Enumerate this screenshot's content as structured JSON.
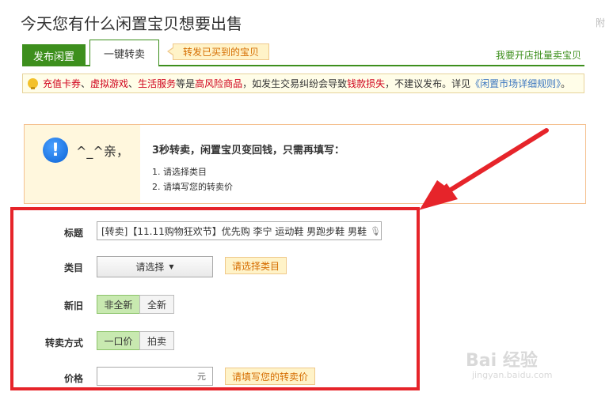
{
  "page": {
    "title": "今天您有什么闲置宝贝想要出售",
    "edge_text": "附"
  },
  "tabs": {
    "publish": "发布闲置",
    "one_click": "一键转卖",
    "bubble": "转发已买到的宝贝",
    "shop_link": "我要开店批量卖宝贝"
  },
  "warning": {
    "parts": [
      {
        "text": "充值卡券",
        "style": "red"
      },
      {
        "text": "、",
        "style": "normal"
      },
      {
        "text": "虚拟游戏",
        "style": "red"
      },
      {
        "text": "、",
        "style": "normal"
      },
      {
        "text": "生活服务",
        "style": "red"
      },
      {
        "text": "等是",
        "style": "normal"
      },
      {
        "text": "高风险商品",
        "style": "red"
      },
      {
        "text": "，如发生交易纠纷会导致",
        "style": "normal"
      },
      {
        "text": "钱款损失",
        "style": "red"
      },
      {
        "text": "，不建议发布。详见",
        "style": "normal"
      },
      {
        "text": "《闲置市场详细规则》",
        "style": "blue"
      },
      {
        "text": "。",
        "style": "normal"
      }
    ]
  },
  "notice": {
    "greeting": "^_^亲，",
    "title": "3秒转卖，闲置宝贝变回钱，只需再填写：",
    "steps": [
      "1. 请选择类目",
      "2. 请填写您的转卖价"
    ]
  },
  "form": {
    "title_label": "标题",
    "title_value": "[转卖]【11.11购物狂欢节】优先购 李宁 运动鞋 男跑步鞋 男鞋",
    "category_label": "类目",
    "category_select": "请选择",
    "category_tip": "请选择类目",
    "condition_label": "新旧",
    "condition_options": [
      "非全新",
      "全新"
    ],
    "resale_label": "转卖方式",
    "resale_options": [
      "一口价",
      "拍卖"
    ],
    "price_label": "价格",
    "price_unit": "元",
    "price_tip": "请填写您的转卖价"
  },
  "watermark": {
    "brand": "Bai 经验",
    "url": "jingyan.baidu.com"
  },
  "colors": {
    "accent_green": "#3d8f1d",
    "highlight_red": "#e6242a",
    "warning_red": "#d0011b",
    "link_blue": "#3b76c0",
    "tip_orange": "#d56d00"
  }
}
